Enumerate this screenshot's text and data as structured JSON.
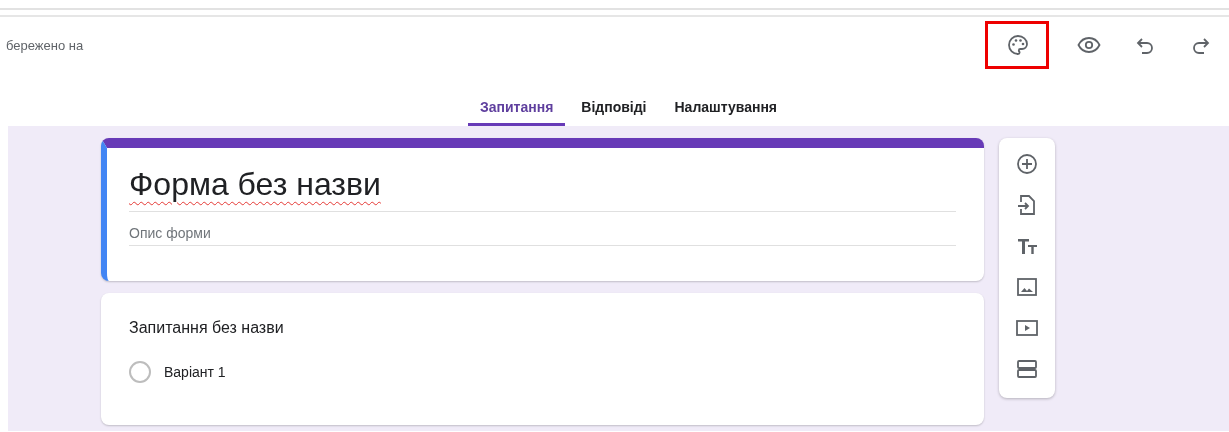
{
  "header": {
    "save_status": "бережено на",
    "toolbar": [
      {
        "kind": "palette",
        "highlighted": true
      },
      {
        "kind": "preview",
        "highlighted": false
      },
      {
        "kind": "undo",
        "highlighted": false
      },
      {
        "kind": "redo",
        "highlighted": false
      }
    ]
  },
  "tabs": [
    {
      "label": "Запитання",
      "selected": true
    },
    {
      "label": "Відповіді",
      "selected": false
    },
    {
      "label": "Налаштування",
      "selected": false
    }
  ],
  "form": {
    "title": "Форма без назви",
    "description_placeholder": "Опис форми"
  },
  "question": {
    "title": "Запитання без назви",
    "options": [
      {
        "label": "Варіант 1",
        "selected": false
      }
    ]
  },
  "side_toolbar": [
    {
      "kind": "add"
    },
    {
      "kind": "import"
    },
    {
      "kind": "text"
    },
    {
      "kind": "image"
    },
    {
      "kind": "video"
    },
    {
      "kind": "section"
    }
  ]
}
